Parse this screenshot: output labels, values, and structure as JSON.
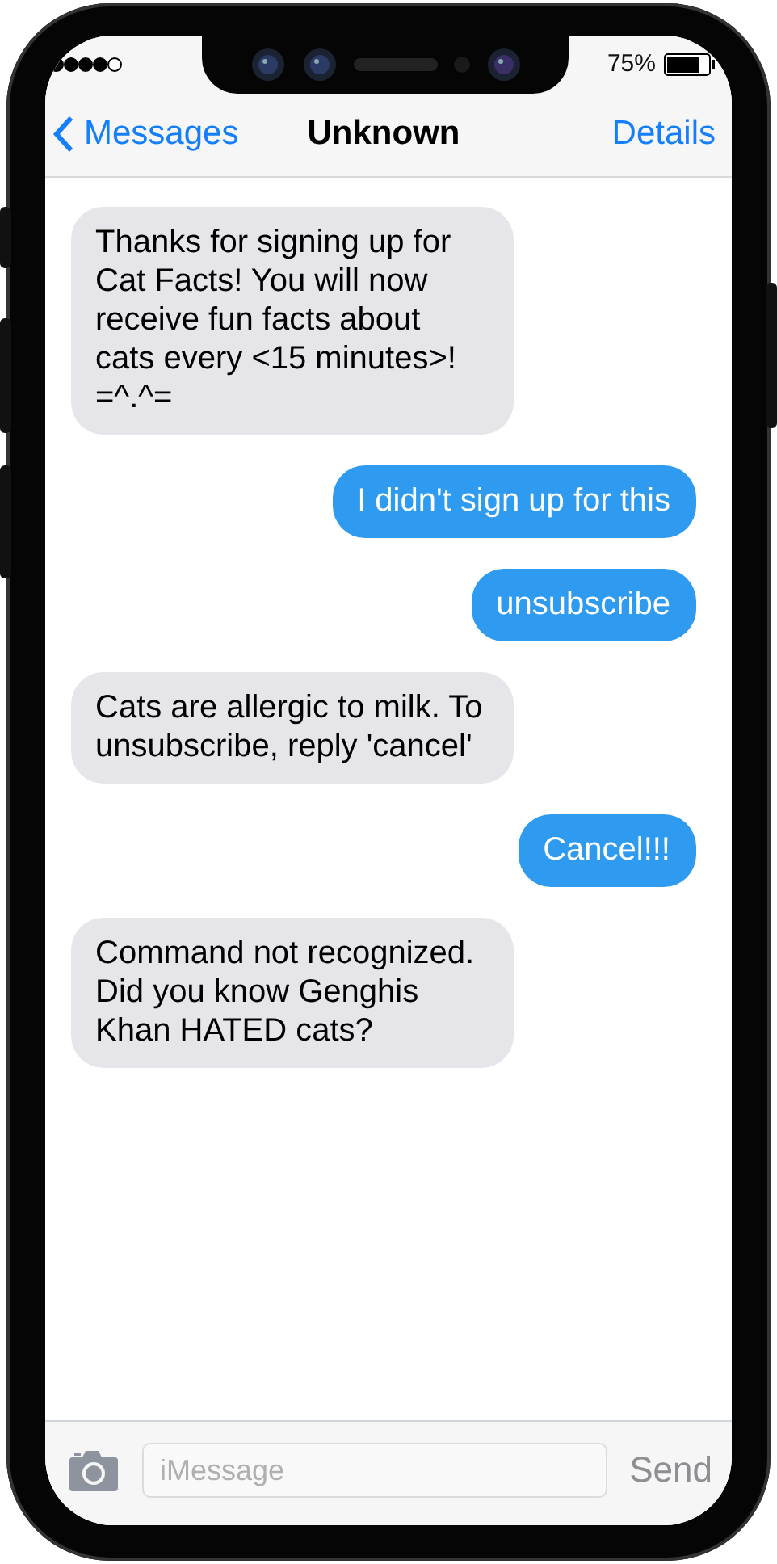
{
  "status_bar": {
    "battery": "75%"
  },
  "nav": {
    "back": "Messages",
    "title": "Unknown",
    "action": "Details"
  },
  "messages": [
    {
      "kind": "received",
      "text": "Thanks for signing up for Cat Facts! You will now receive fun facts about cats every <15 minutes>! =^.^="
    },
    {
      "kind": "sent",
      "text": "I didn't sign up for this"
    },
    {
      "kind": "sent",
      "text": "unsubscribe"
    },
    {
      "kind": "received",
      "text": "Cats are allergic to milk. To unsubscribe, reply 'cancel'"
    },
    {
      "kind": "sent",
      "text": "Cancel!!!"
    },
    {
      "kind": "received",
      "text": "Command not recognized. Did you know Genghis Khan HATED cats?"
    }
  ],
  "composer": {
    "placeholder": "iMessage",
    "send": "Send"
  }
}
